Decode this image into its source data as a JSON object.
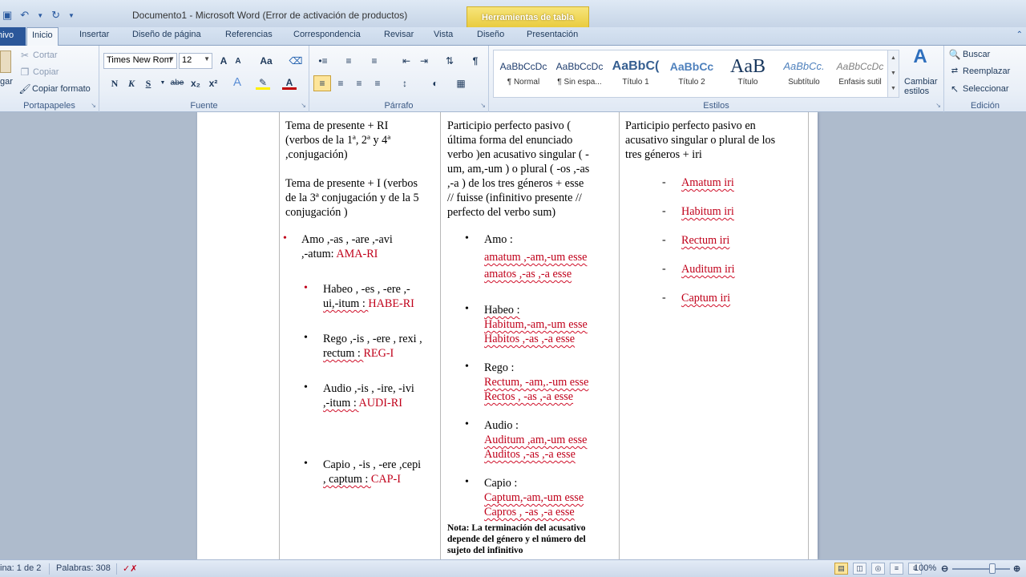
{
  "window": {
    "title": "Documento1  -  Microsoft Word (Error de activación de productos)",
    "context_tab": "Herramientas de tabla"
  },
  "tabs": {
    "file": "hivo",
    "items": [
      "Inicio",
      "Insertar",
      "Diseño de página",
      "Referencias",
      "Correspondencia",
      "Revisar",
      "Vista",
      "Diseño",
      "Presentación"
    ]
  },
  "ribbon": {
    "clipboard": {
      "paste": "gar",
      "cut": "Cortar",
      "copy": "Copiar",
      "format_painter": "Copiar formato",
      "label": "Portapapeles"
    },
    "font": {
      "name": "Times New Rom",
      "size": "12",
      "label": "Fuente",
      "bold": "N",
      "italic": "K",
      "underline": "S",
      "strike": "abe",
      "sub": "x₂",
      "sup": "x²",
      "grow": "A",
      "shrink": "A",
      "case": "Aa",
      "color": "A"
    },
    "paragraph": {
      "label": "Párrafo",
      "pilcrow": "¶"
    },
    "styles": {
      "label": "Estilos",
      "items": [
        {
          "sample": "AaBbCcDc",
          "name": "¶ Normal"
        },
        {
          "sample": "AaBbCcDc",
          "name": "¶ Sin espa..."
        },
        {
          "sample": "AaBbC(",
          "name": "Título 1"
        },
        {
          "sample": "AaBbCc",
          "name": "Título 2"
        },
        {
          "sample": "AaB",
          "name": "Título"
        },
        {
          "sample": "AaBbCc.",
          "name": "Subtítulo"
        },
        {
          "sample": "AaBbCcDc",
          "name": "Énfasis sutil"
        }
      ],
      "change": "Cambiar",
      "change2": "estilos"
    },
    "editing": {
      "label": "Edición",
      "find": "Buscar",
      "replace": "Reemplazar",
      "select": "Seleccionar"
    }
  },
  "document": {
    "col1": {
      "p1": [
        "Tema de presente + RI",
        "(verbos de la 1ª, 2ª y 4ª",
        ",conjugación)"
      ],
      "p2": [
        "Tema de presente + I (verbos",
        "de la 3ª conjugación y de la 5",
        "conjugación  )"
      ],
      "bullets": [
        {
          "line1": "Amo ,-as , -are ,-avi",
          "line2a": ",-atum:  ",
          "line2b": "AMA-RI"
        },
        {
          "line1": "Habeo , -es , -ere ,-",
          "line2a": "ui,-itum : ",
          "line2b": "HABE-RI"
        },
        {
          "line1": "Rego ,-is , -ere , rexi ,",
          "line2a": "rectum : ",
          "line2b": "REG-I"
        },
        {
          "line1": "Audio ,-is , -ire, -ivi",
          "line2a": ",-itum : ",
          "line2b": "AUDI-RI"
        },
        {
          "line1": "Capio , -is , -ere ,cepi",
          "line2a": ", captum : ",
          "line2b": "CAP-I"
        }
      ]
    },
    "col2": {
      "intro": [
        "Participio  perfecto pasivo  (",
        "última forma del enunciado",
        "verbo )en acusativo singular  ( -",
        "um, am,-um  )  o plural  ( -os ,-as",
        ",-a )   de los tres géneros  +  esse",
        "// fuisse (infinitivo presente //",
        "perfecto del verbo sum)"
      ],
      "bullets": [
        {
          "head": "Amo :",
          "l1": "amatum ,-am,-um  esse",
          "l2": "amatos ,-as ,-a esse"
        },
        {
          "head": "Habeo :",
          "l1": "Habitum,-am,-um  esse",
          "l2": "Habitos ,-as ,-a esse"
        },
        {
          "head": "Rego :",
          "l1": "Rectum, -am,.-um  esse",
          "l2": "Rectos , -as ,-a  esse"
        },
        {
          "head": "Audio :",
          "l1": "Auditum ,am,-um  esse",
          "l2": "Auditos ,-as ,-a   esse"
        },
        {
          "head": "Capio :",
          "l1": "Captum,-am,-um  esse",
          "l2": "Capros , -as ,-a  esse"
        }
      ],
      "nota_label": "Nota",
      "nota": [
        ": La terminación del acusativo",
        "depende del género y el número del",
        "sujeto del infinitivo"
      ]
    },
    "col3": {
      "intro": [
        "Participio  perfecto pasivo en",
        "acusativo singular  o plural  de los",
        "tres géneros  +  iri"
      ],
      "items": [
        "Amatum iri",
        "Habitum iri",
        "Rectum iri",
        "Auditum iri",
        "Captum iri"
      ]
    }
  },
  "status": {
    "page": "ina: 1 de 2",
    "words": "Palabras: 308",
    "zoom": "100%"
  }
}
